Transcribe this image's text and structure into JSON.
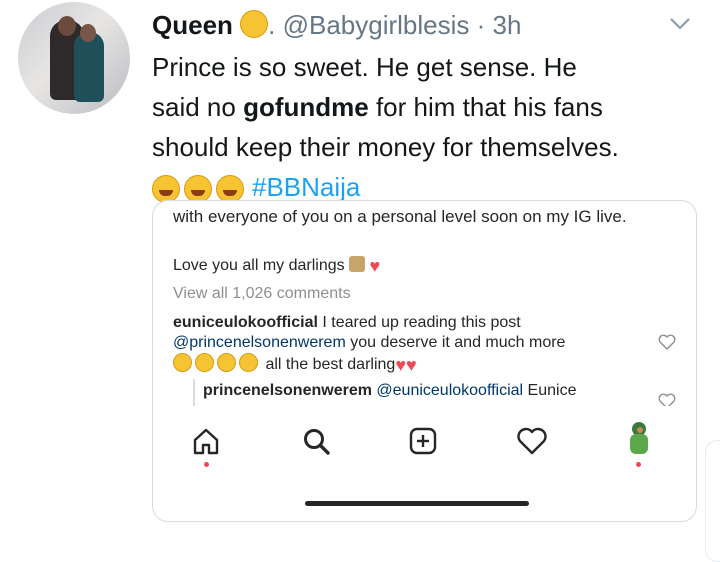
{
  "tweet": {
    "display_name": "Queen",
    "handle_time": ". @Babygirlblesis · 3h",
    "text_line1": "Prince is so sweet. He get sense. He",
    "text_line2_prefix": "said no ",
    "text_line2_bold": "gofundme",
    "text_line2_suffix": " for him that his fans",
    "text_line3": "should keep their money for themselves.",
    "hashtag": "#BBNaija",
    "emojis": [
      "rofl-emoji",
      "rofl-emoji",
      "rofl-emoji"
    ],
    "name_emoji": "hugging-face-emoji"
  },
  "instagram": {
    "cut_off_text": "with everyone of you on a personal level soon on my IG live.",
    "caption_text": "Love you all my darlings",
    "caption_emojis": [
      "carousel-horse-emoji",
      "red-heart-emoji"
    ],
    "view_all": "View all 1,026 comments",
    "comment1_user": "euniceulokoofficial",
    "comment1_text1": " I teared up reading this post",
    "comment1_mention": "@princenelsonenwerem",
    "comment1_text2": " you deserve it and much more",
    "comment1_text3": " all the best darling",
    "comment1_emojis": [
      "kissing-face-emoji",
      "kissing-face-emoji",
      "kissing-face-emoji",
      "kissing-face-emoji"
    ],
    "reply_user": "princenelsonenwerem",
    "reply_mention": "@euniceulokoofficial",
    "reply_text": " Eunice",
    "nav_icons": [
      "home-icon",
      "search-icon",
      "new-post-icon",
      "activity-heart-icon",
      "profile-avatar-icon"
    ]
  },
  "colors": {
    "hashtag": "#1da1f2",
    "handle": "#657786",
    "ig_heart": "#ed4956",
    "ig_mention": "#00376b"
  }
}
